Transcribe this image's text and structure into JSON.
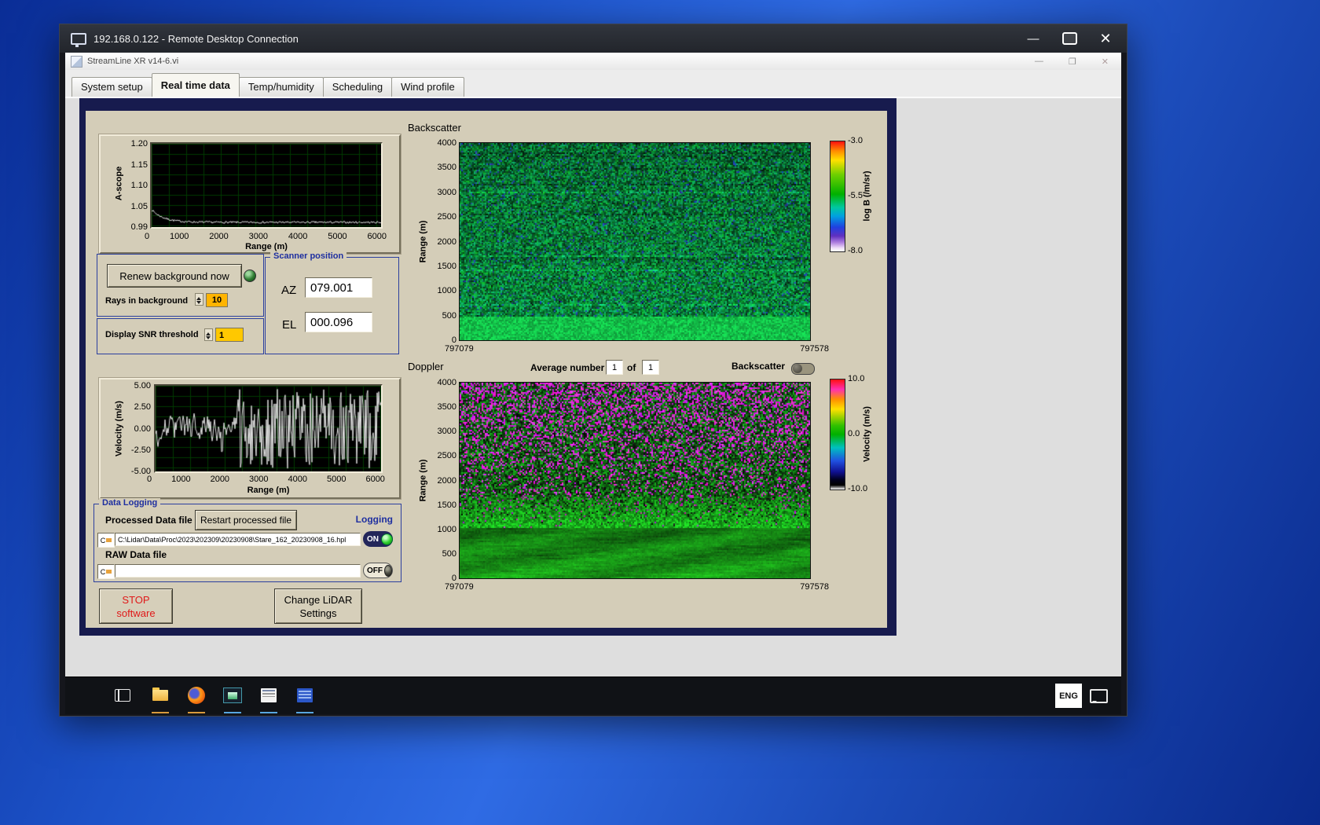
{
  "rdp": {
    "title": "192.168.0.122 - Remote Desktop Connection"
  },
  "app": {
    "title": "StreamLine XR v14-6.vi",
    "tabs": [
      "System setup",
      "Real time data",
      "Temp/humidity",
      "Scheduling",
      "Wind profile"
    ]
  },
  "icons": {
    "minimize": "—",
    "close": "✕",
    "app_min": "—",
    "app_max": "❐",
    "app_close": "✕"
  },
  "ascope": {
    "ylabel": "A-scope",
    "xlabel": "Range (m)",
    "yticks": [
      "1.20",
      "1.15",
      "1.10",
      "1.05",
      "0.99"
    ],
    "xticks": [
      "0",
      "1000",
      "2000",
      "3000",
      "4000",
      "5000",
      "6000"
    ]
  },
  "background_ctrl": {
    "renew": "Renew background now",
    "rays_label": "Rays in background",
    "rays_value": "10",
    "snr_label": "Display SNR threshold",
    "snr_value": "1"
  },
  "scanner": {
    "title": "Scanner position",
    "az": "AZ",
    "az_value": "079.001",
    "el": "EL",
    "el_value": "000.096"
  },
  "backscatter": {
    "title": "Backscatter",
    "ylabel": "Range (m)",
    "yticks": [
      "4000",
      "3500",
      "3000",
      "2500",
      "2000",
      "1500",
      "1000",
      "500",
      "0"
    ],
    "xcorners": [
      "797079",
      "797578"
    ],
    "cb_title": "log B (/m/sr)",
    "cb_ticks": [
      "-3.0",
      "-5.5",
      "-8.0"
    ]
  },
  "doppler": {
    "title": "Doppler",
    "avg_label": "Average number",
    "avg_value": "1",
    "of": "of",
    "of_value": "1",
    "toggle_label": "Backscatter",
    "ylabel": "Range (m)",
    "yticks": [
      "4000",
      "3500",
      "3000",
      "2500",
      "2000",
      "1500",
      "1000",
      "500",
      "0"
    ],
    "xcorners": [
      "797079",
      "797578"
    ],
    "cb_title": "Velocity (m/s)",
    "cb_ticks": [
      "10.0",
      "0.0",
      "-10.0"
    ]
  },
  "velocity": {
    "ylabel": "Velocity (m/s)",
    "xlabel": "Range (m)",
    "yticks": [
      "5.00",
      "2.50",
      "0.00",
      "-2.50",
      "-5.00"
    ],
    "xticks": [
      "0",
      "1000",
      "2000",
      "3000",
      "4000",
      "5000",
      "6000"
    ]
  },
  "logging": {
    "title": "Data Logging",
    "processed_label": "Processed Data file",
    "restart": "Restart processed file",
    "logging_label": "Logging",
    "drive": "C",
    "processed_path": "C:\\Lidar\\Data\\Proc\\2023\\202309\\20230908\\Stare_162_20230908_16.hpl",
    "raw_label": "RAW Data file",
    "raw_path": "",
    "on": "ON",
    "off": "OFF"
  },
  "actions": {
    "stop1": "STOP",
    "stop2": "software",
    "change1": "Change LiDAR",
    "change2": "Settings"
  },
  "taskbar": {
    "lang": "ENG"
  },
  "colors": {
    "accent_blue": "#2b3f9e",
    "led_green": "#2fd02f",
    "value_orange": "#ffb400",
    "value_yellow": "#ffc800"
  }
}
